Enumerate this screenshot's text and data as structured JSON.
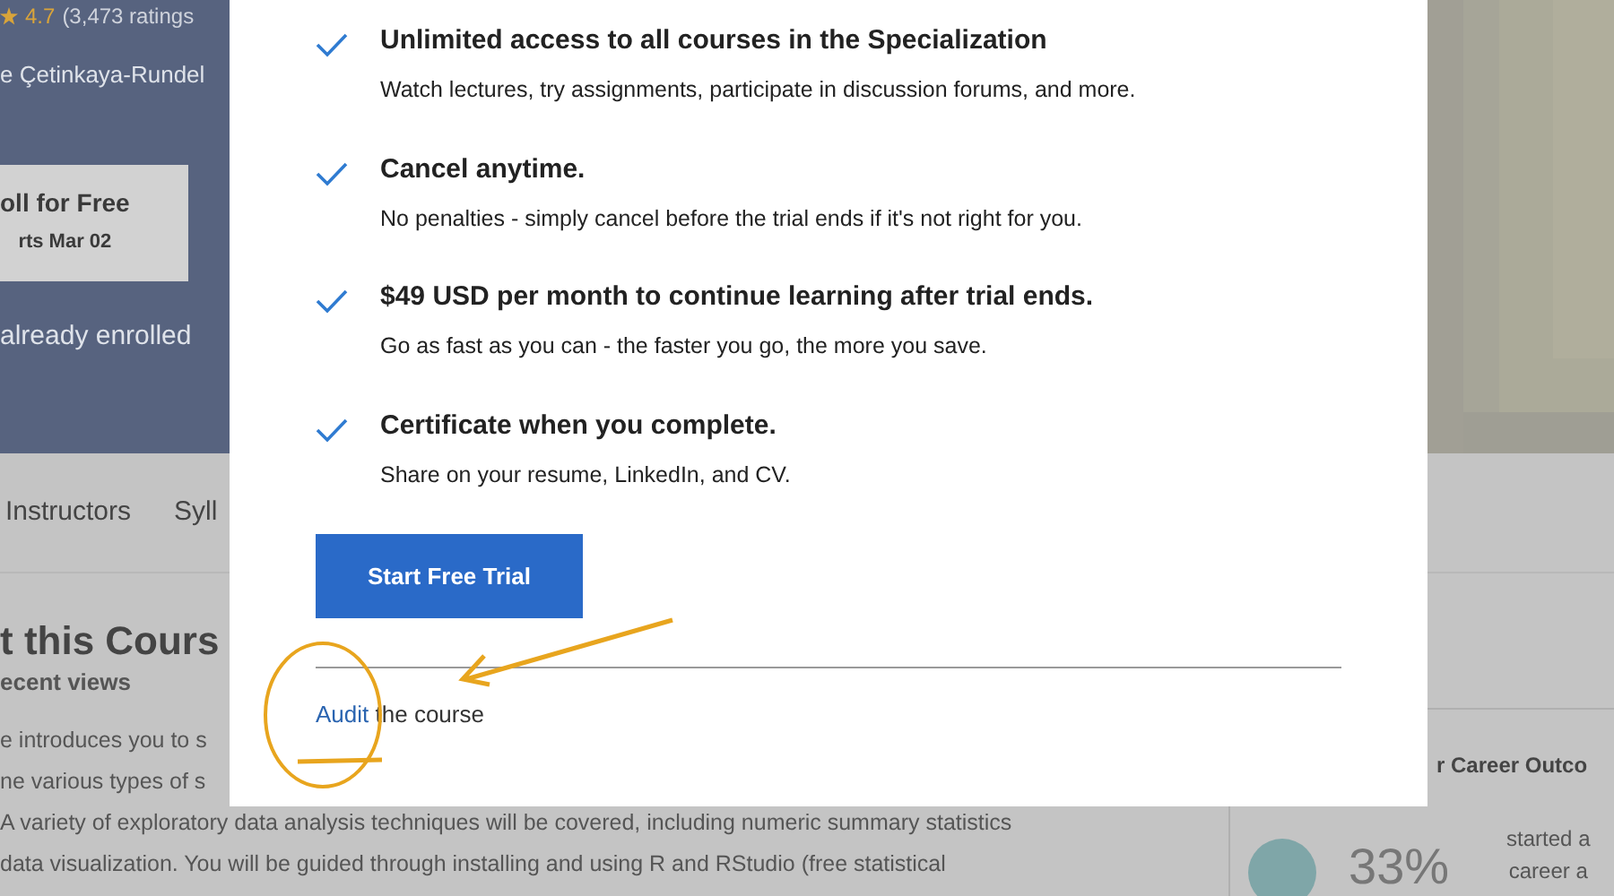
{
  "header": {
    "rating": "4.7",
    "ratings_count": "(3,473 ratings",
    "instructor": "e Çetinkaya-Rundel",
    "enroll_button": {
      "label": "oll for Free",
      "sublabel": "rts Mar 02"
    },
    "enrolled_note": "already enrolled"
  },
  "tabs": [
    {
      "label": "Instructors",
      "selected": false
    },
    {
      "label": "Syll",
      "selected": false
    }
  ],
  "about": {
    "heading": "t this Cours",
    "views": "ecent views",
    "lines": [
      "e introduces you to s",
      "ne various types of s",
      "A variety of exploratory data analysis techniques will be covered, including numeric summary statistics",
      "data visualization. You will be guided through installing and using R and RStudio (free statistical"
    ]
  },
  "career": {
    "title": "r Career Outco",
    "percent": "33%",
    "lines": [
      "started a",
      "career a"
    ]
  },
  "modal": {
    "benefits": [
      {
        "title": "Unlimited access to all courses in the Specialization",
        "description": "Watch lectures, try assignments, participate in discussion forums, and more."
      },
      {
        "title": "Cancel anytime.",
        "description": "No penalties - simply cancel before the trial ends if it's not right for you."
      },
      {
        "title": "$49 USD per month to continue learning after trial ends.",
        "description": "Go as fast as you can - the faster you go, the more you save."
      },
      {
        "title": "Certificate when you complete.",
        "description": "Share on your resume, LinkedIn, and CV."
      }
    ],
    "button": "Start Free Trial",
    "audit_link": "Audit",
    "audit_rest": "the course"
  }
}
